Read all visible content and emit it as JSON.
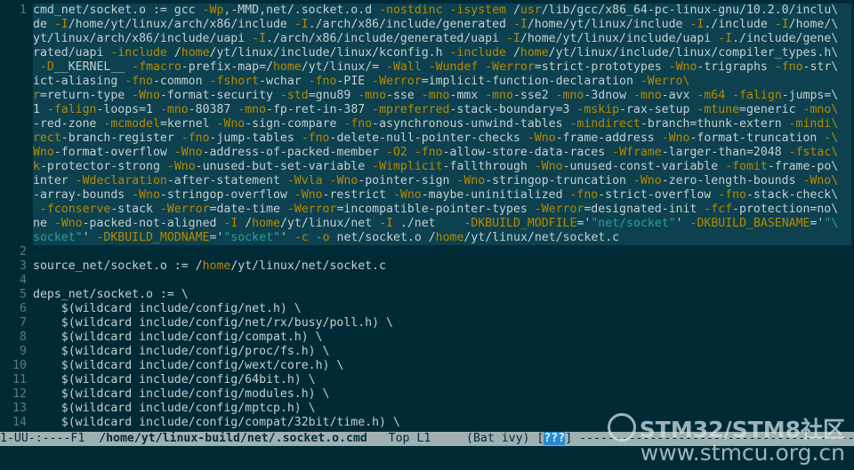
{
  "editor": {
    "lines": [
      {
        "n": "1",
        "hl": true,
        "segs": [
          [
            "cmd_net/socket.o := gcc ",
            ""
          ],
          [
            "-Wp",
            "sw"
          ],
          [
            ",-MMD,net/.socket.o.d ",
            ""
          ],
          [
            "-nostdinc",
            "sw"
          ],
          [
            " ",
            ""
          ],
          [
            "-isystem",
            "sw"
          ],
          [
            " /",
            ""
          ],
          [
            "usr",
            "sw"
          ],
          [
            "/lib/gcc/x86_64-pc-linux-gnu/10.2.0/inclu\\",
            ""
          ]
        ]
      },
      {
        "n": "",
        "hl": true,
        "segs": [
          [
            "de ",
            ""
          ],
          [
            "-I",
            "sw"
          ],
          [
            "/home/yt/linux/arch/x86/include ",
            ""
          ],
          [
            "-I",
            "sw"
          ],
          [
            "./arch/x86/include/generated ",
            ""
          ],
          [
            "-I",
            "sw"
          ],
          [
            "/home/yt/linux/include ",
            ""
          ],
          [
            "-I",
            "sw"
          ],
          [
            "./include ",
            ""
          ],
          [
            "-I",
            "sw"
          ],
          [
            "/home/\\",
            ""
          ]
        ]
      },
      {
        "n": "",
        "hl": true,
        "segs": [
          [
            "yt/linux/arch/x86/include/uapi ",
            ""
          ],
          [
            "-I",
            "sw"
          ],
          [
            "./arch/x86/include/generated/uapi ",
            ""
          ],
          [
            "-I",
            "sw"
          ],
          [
            "/home/yt/linux/include/uapi ",
            ""
          ],
          [
            "-I",
            "sw"
          ],
          [
            "./include/gene\\",
            ""
          ]
        ]
      },
      {
        "n": "",
        "hl": true,
        "segs": [
          [
            "rated/uapi ",
            ""
          ],
          [
            "-include",
            "sw"
          ],
          [
            " /",
            ""
          ],
          [
            "home",
            "sw"
          ],
          [
            "/yt/linux/include/linux/kconfig.h ",
            ""
          ],
          [
            "-include",
            "sw"
          ],
          [
            " /",
            ""
          ],
          [
            "home",
            "sw"
          ],
          [
            "/yt/linux/include/linux/compiler_types.h\\",
            ""
          ]
        ]
      },
      {
        "n": "",
        "hl": true,
        "segs": [
          [
            " ",
            ""
          ],
          [
            "-D",
            "sw"
          ],
          [
            "__KERNEL__ ",
            ""
          ],
          [
            "-fmacro",
            "sw"
          ],
          [
            "-prefix-map=/",
            ""
          ],
          [
            "home",
            "sw"
          ],
          [
            "/yt/linux/= ",
            ""
          ],
          [
            "-Wall",
            "sw"
          ],
          [
            " ",
            ""
          ],
          [
            "-Wundef",
            "sw"
          ],
          [
            " ",
            ""
          ],
          [
            "-Werror",
            "sw"
          ],
          [
            "=strict-prototypes ",
            ""
          ],
          [
            "-Wno",
            "sw"
          ],
          [
            "-trigraphs ",
            ""
          ],
          [
            "-fno",
            "sw"
          ],
          [
            "-str\\",
            ""
          ]
        ]
      },
      {
        "n": "",
        "hl": true,
        "segs": [
          [
            "ict-aliasing ",
            ""
          ],
          [
            "-fno",
            "sw"
          ],
          [
            "-common ",
            ""
          ],
          [
            "-fshort",
            "sw"
          ],
          [
            "-wchar ",
            ""
          ],
          [
            "-fno",
            "sw"
          ],
          [
            "-PIE ",
            ""
          ],
          [
            "-Werror",
            "sw"
          ],
          [
            "=implicit-function-declaration ",
            ""
          ],
          [
            "-Werro\\",
            "sw"
          ]
        ]
      },
      {
        "n": "",
        "hl": true,
        "segs": [
          [
            "r",
            "sw"
          ],
          [
            "=return-type ",
            ""
          ],
          [
            "-Wno",
            "sw"
          ],
          [
            "-format-security ",
            ""
          ],
          [
            "-std",
            "sw"
          ],
          [
            "=gnu89 ",
            ""
          ],
          [
            "-mno",
            "sw"
          ],
          [
            "-sse ",
            ""
          ],
          [
            "-mno",
            "sw"
          ],
          [
            "-mmx ",
            ""
          ],
          [
            "-mno",
            "sw"
          ],
          [
            "-sse2 ",
            ""
          ],
          [
            "-mno",
            "sw"
          ],
          [
            "-3dnow ",
            ""
          ],
          [
            "-mno",
            "sw"
          ],
          [
            "-avx ",
            ""
          ],
          [
            "-m64",
            "sw"
          ],
          [
            " ",
            ""
          ],
          [
            "-falign",
            "sw"
          ],
          [
            "-jumps=\\",
            ""
          ]
        ]
      },
      {
        "n": "",
        "hl": true,
        "segs": [
          [
            "1 ",
            ""
          ],
          [
            "-falign",
            "sw"
          ],
          [
            "-loops=1 ",
            ""
          ],
          [
            "-mno",
            "sw"
          ],
          [
            "-80387 ",
            ""
          ],
          [
            "-mno",
            "sw"
          ],
          [
            "-fp-ret-in-387 ",
            ""
          ],
          [
            "-mpreferred",
            "sw"
          ],
          [
            "-stack-boundary=3 ",
            ""
          ],
          [
            "-mskip",
            "sw"
          ],
          [
            "-rax-setup ",
            ""
          ],
          [
            "-mtune",
            "sw"
          ],
          [
            "=generic ",
            ""
          ],
          [
            "-mno\\",
            "sw"
          ]
        ]
      },
      {
        "n": "",
        "hl": true,
        "segs": [
          [
            "-red-zone ",
            ""
          ],
          [
            "-mcmodel",
            "sw"
          ],
          [
            "=kernel ",
            ""
          ],
          [
            "-Wno",
            "sw"
          ],
          [
            "-sign-compare ",
            ""
          ],
          [
            "-fno",
            "sw"
          ],
          [
            "-asynchronous-unwind-tables ",
            ""
          ],
          [
            "-mindirect",
            "sw"
          ],
          [
            "-branch=thunk-extern ",
            ""
          ],
          [
            "-mindi\\",
            "sw"
          ]
        ]
      },
      {
        "n": "",
        "hl": true,
        "segs": [
          [
            "rect",
            "sw"
          ],
          [
            "-branch-register ",
            ""
          ],
          [
            "-fno",
            "sw"
          ],
          [
            "-jump-tables ",
            ""
          ],
          [
            "-fno",
            "sw"
          ],
          [
            "-delete-null-pointer-checks ",
            ""
          ],
          [
            "-Wno",
            "sw"
          ],
          [
            "-frame-address ",
            ""
          ],
          [
            "-Wno",
            "sw"
          ],
          [
            "-format-truncation ",
            ""
          ],
          [
            "-\\",
            "sw"
          ]
        ]
      },
      {
        "n": "",
        "hl": true,
        "segs": [
          [
            "Wno",
            "sw"
          ],
          [
            "-format-overflow ",
            ""
          ],
          [
            "-Wno",
            "sw"
          ],
          [
            "-address-of-packed-member ",
            ""
          ],
          [
            "-O2",
            "sw"
          ],
          [
            " ",
            ""
          ],
          [
            "-fno",
            "sw"
          ],
          [
            "-allow-store-data-races ",
            ""
          ],
          [
            "-Wframe",
            "sw"
          ],
          [
            "-larger-than=2048 ",
            ""
          ],
          [
            "-fstac\\",
            "sw"
          ]
        ]
      },
      {
        "n": "",
        "hl": true,
        "segs": [
          [
            "k",
            "sw"
          ],
          [
            "-protector-strong ",
            ""
          ],
          [
            "-Wno",
            "sw"
          ],
          [
            "-unused-but-set-variable ",
            ""
          ],
          [
            "-Wimplicit",
            "sw"
          ],
          [
            "-fallthrough ",
            ""
          ],
          [
            "-Wno",
            "sw"
          ],
          [
            "-unused-const-variable ",
            ""
          ],
          [
            "-fomit",
            "sw"
          ],
          [
            "-frame-po\\",
            ""
          ]
        ]
      },
      {
        "n": "",
        "hl": true,
        "segs": [
          [
            "inter ",
            ""
          ],
          [
            "-Wdeclaration",
            "sw"
          ],
          [
            "-after-statement ",
            ""
          ],
          [
            "-Wvla",
            "sw"
          ],
          [
            " ",
            ""
          ],
          [
            "-Wno",
            "sw"
          ],
          [
            "-pointer-sign ",
            ""
          ],
          [
            "-Wno",
            "sw"
          ],
          [
            "-stringop-truncation ",
            ""
          ],
          [
            "-Wno",
            "sw"
          ],
          [
            "-zero-length-bounds ",
            ""
          ],
          [
            "-Wno\\",
            "sw"
          ]
        ]
      },
      {
        "n": "",
        "hl": true,
        "segs": [
          [
            "-array-bounds ",
            ""
          ],
          [
            "-Wno",
            "sw"
          ],
          [
            "-stringop-overflow ",
            ""
          ],
          [
            "-Wno",
            "sw"
          ],
          [
            "-restrict ",
            ""
          ],
          [
            "-Wno",
            "sw"
          ],
          [
            "-maybe-uninitialized ",
            ""
          ],
          [
            "-fno",
            "sw"
          ],
          [
            "-strict-overflow ",
            ""
          ],
          [
            "-fno",
            "sw"
          ],
          [
            "-stack-check\\",
            ""
          ]
        ]
      },
      {
        "n": "",
        "hl": true,
        "segs": [
          [
            " ",
            ""
          ],
          [
            "-fconserve",
            "sw"
          ],
          [
            "-stack ",
            ""
          ],
          [
            "-Werror",
            "sw"
          ],
          [
            "=date-time ",
            ""
          ],
          [
            "-Werror",
            "sw"
          ],
          [
            "=incompatible-pointer-types ",
            ""
          ],
          [
            "-Werror",
            "sw"
          ],
          [
            "=designated-init ",
            ""
          ],
          [
            "-fcf",
            "sw"
          ],
          [
            "-protection=no\\",
            ""
          ]
        ]
      },
      {
        "n": "",
        "hl": true,
        "segs": [
          [
            "ne ",
            ""
          ],
          [
            "-Wno",
            "sw"
          ],
          [
            "-packed-not-aligned ",
            ""
          ],
          [
            "-I",
            "sw"
          ],
          [
            " /",
            ""
          ],
          [
            "home",
            "sw"
          ],
          [
            "/yt/linux/net ",
            ""
          ],
          [
            "-I",
            "sw"
          ],
          [
            " ./net    ",
            ""
          ],
          [
            "-DKBUILD_MODFILE",
            "sw"
          ],
          [
            "='",
            ""
          ],
          [
            "\"net/socket\"",
            "st"
          ],
          [
            "' ",
            ""
          ],
          [
            "-DKBUILD_BASENAME",
            "sw"
          ],
          [
            "='",
            ""
          ],
          [
            "\"\\",
            "st"
          ]
        ]
      },
      {
        "n": "",
        "hl": true,
        "segs": [
          [
            "socket\"",
            "st"
          ],
          [
            "' ",
            ""
          ],
          [
            "-DKBUILD_MODNAME",
            "sw"
          ],
          [
            "='",
            ""
          ],
          [
            "\"socket\"",
            "st"
          ],
          [
            "' ",
            ""
          ],
          [
            "-c",
            "sw"
          ],
          [
            " ",
            ""
          ],
          [
            "-o",
            "sw"
          ],
          [
            " net/socket.o /",
            ""
          ],
          [
            "home",
            "sw"
          ],
          [
            "/yt/linux/net/socket.c",
            ""
          ]
        ]
      },
      {
        "n": "2",
        "hl": false,
        "segs": [
          [
            "",
            ""
          ]
        ]
      },
      {
        "n": "3",
        "hl": false,
        "segs": [
          [
            "source_net/socket.o := /",
            ""
          ],
          [
            "home",
            "sw"
          ],
          [
            "/yt/linux/net/socket.c",
            ""
          ]
        ]
      },
      {
        "n": "4",
        "hl": false,
        "segs": [
          [
            "",
            ""
          ]
        ]
      },
      {
        "n": "5",
        "hl": false,
        "segs": [
          [
            "deps_net/socket.o := \\",
            ""
          ]
        ]
      },
      {
        "n": "6",
        "hl": false,
        "segs": [
          [
            "    $(wildcard include/config/net.h) \\",
            ""
          ]
        ]
      },
      {
        "n": "7",
        "hl": false,
        "segs": [
          [
            "    $(wildcard include/config/net/rx/busy/poll.h) \\",
            ""
          ]
        ]
      },
      {
        "n": "8",
        "hl": false,
        "segs": [
          [
            "    $(wildcard include/config/compat.h) \\",
            ""
          ]
        ]
      },
      {
        "n": "9",
        "hl": false,
        "segs": [
          [
            "    $(wildcard include/config/proc/fs.h) \\",
            ""
          ]
        ]
      },
      {
        "n": "10",
        "hl": false,
        "segs": [
          [
            "    $(wildcard include/config/wext/core.h) \\",
            ""
          ]
        ]
      },
      {
        "n": "11",
        "hl": false,
        "segs": [
          [
            "    $(wildcard include/config/64bit.h) \\",
            ""
          ]
        ]
      },
      {
        "n": "12",
        "hl": false,
        "segs": [
          [
            "    $(wildcard include/config/modules.h) \\",
            ""
          ]
        ]
      },
      {
        "n": "13",
        "hl": false,
        "segs": [
          [
            "    $(wildcard include/config/mptcp.h) \\",
            ""
          ]
        ]
      },
      {
        "n": "14",
        "hl": false,
        "segs": [
          [
            "    $(wildcard include/config/compat/32bit/time.h) \\",
            ""
          ]
        ]
      }
    ]
  },
  "modeline": {
    "state": "1-UU-:----F1  ",
    "buffer": "/home/yt/linux-build/net/.socket.o.cmd",
    "position": "   Top L1     ",
    "mode": "(Bat ivy) [",
    "badge": "???",
    "tail": "] -----------------------------------------------------------"
  },
  "watermark": {
    "title": "STM32/STM8社区",
    "url": "www.stmcu.org.cn"
  },
  "colors": {
    "background": "#002b36",
    "switch": "#b58900",
    "string": "#2aa198",
    "highlight": "#0d4150",
    "modeline": "#9fb0b2"
  }
}
